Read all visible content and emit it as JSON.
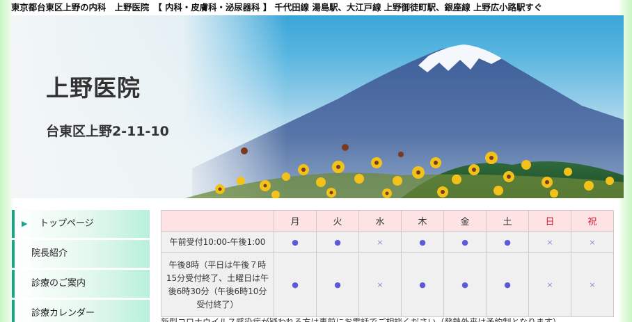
{
  "header": {
    "topbar_text": "東京都台東区上野の内科　上野医院　【 内科・皮膚科・泌尿器科 】 千代田線 湯島駅、大江戸線 上野御徒町駅、銀座線 上野広小路駅すぐ"
  },
  "banner": {
    "title": "上野医院",
    "address": "台東区上野2-11-10"
  },
  "nav": {
    "items": [
      {
        "label": "トップページ"
      },
      {
        "label": "院長紹介"
      },
      {
        "label": "診療のご案内"
      },
      {
        "label": "診療カレンダー"
      }
    ]
  },
  "schedule": {
    "days": [
      "月",
      "火",
      "水",
      "木",
      "金",
      "土",
      "日",
      "祝"
    ],
    "rows": [
      {
        "label": "午前受付10:00-午後1:00",
        "marks": [
          "●",
          "●",
          "×",
          "●",
          "●",
          "●",
          "×",
          "×"
        ]
      },
      {
        "label": "午後8時（平日は午後７時15分受付終了、土曜日は午後6時30分（午後6時10分受付終了）",
        "marks": [
          "●",
          "●",
          "×",
          "●",
          "●",
          "●",
          "×",
          "×"
        ]
      }
    ]
  },
  "footer_partial_text": "新型コロナウイルス感染症が疑われる方は事前にお電話でご相談ください（発熱外来は予約制となります）",
  "colors": {
    "accent": "#1aa68a",
    "sunday": "#d81b3a",
    "header_bg": "#fde3e3",
    "mark": "#5b5bd6"
  }
}
